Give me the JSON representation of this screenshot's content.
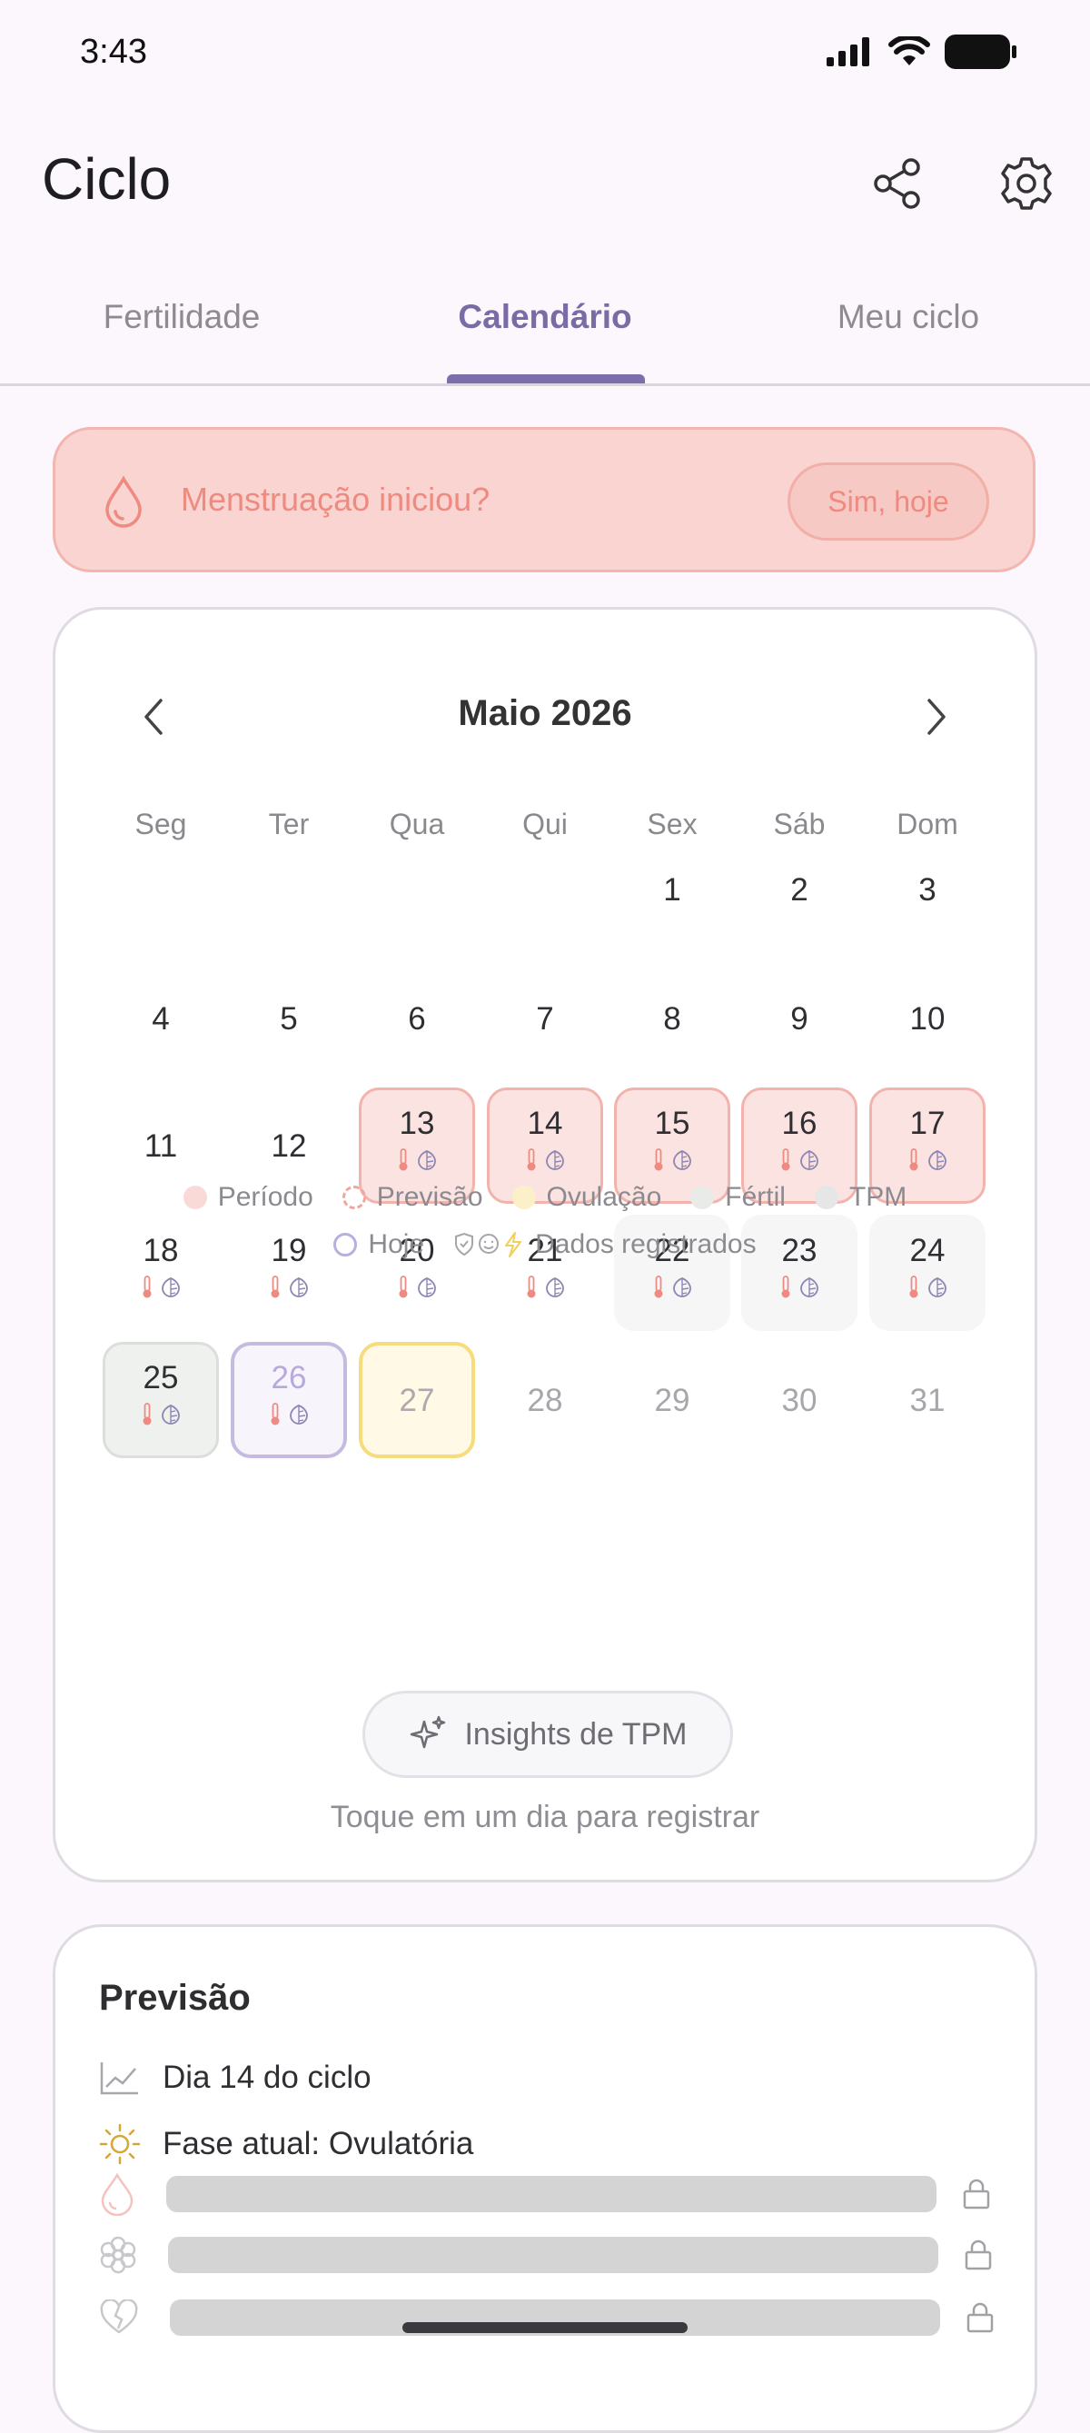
{
  "status_bar": {
    "time": "3:43"
  },
  "header": {
    "title": "Ciclo",
    "share_icon": "share-icon",
    "settings_icon": "gear-icon"
  },
  "tabs": [
    {
      "label": "Fertilidade",
      "active": false
    },
    {
      "label": "Calendário",
      "active": true
    },
    {
      "label": "Meu ciclo",
      "active": false
    }
  ],
  "period_banner": {
    "question": "Menstruação iniciou?",
    "button_label": "Sim, hoje"
  },
  "calendar": {
    "month_label": "Maio 2026",
    "weekdays": [
      "Seg",
      "Ter",
      "Qua",
      "Qui",
      "Sex",
      "Sáb",
      "Dom"
    ],
    "days": [
      {
        "n": "1",
        "state": "normal",
        "icons": false
      },
      {
        "n": "2",
        "state": "normal",
        "icons": false
      },
      {
        "n": "3",
        "state": "normal",
        "icons": false
      },
      {
        "n": "4",
        "state": "normal",
        "icons": false
      },
      {
        "n": "5",
        "state": "normal",
        "icons": false
      },
      {
        "n": "6",
        "state": "normal",
        "icons": false
      },
      {
        "n": "7",
        "state": "normal",
        "icons": false
      },
      {
        "n": "8",
        "state": "normal",
        "icons": false
      },
      {
        "n": "9",
        "state": "normal",
        "icons": false
      },
      {
        "n": "10",
        "state": "normal",
        "icons": false
      },
      {
        "n": "11",
        "state": "normal",
        "icons": false
      },
      {
        "n": "12",
        "state": "normal",
        "icons": false
      },
      {
        "n": "13",
        "state": "period",
        "icons": true
      },
      {
        "n": "14",
        "state": "period",
        "icons": true
      },
      {
        "n": "15",
        "state": "period",
        "icons": true
      },
      {
        "n": "16",
        "state": "period",
        "icons": true
      },
      {
        "n": "17",
        "state": "period",
        "icons": true
      },
      {
        "n": "18",
        "state": "normal",
        "icons": true
      },
      {
        "n": "19",
        "state": "normal",
        "icons": true
      },
      {
        "n": "20",
        "state": "normal",
        "icons": true
      },
      {
        "n": "21",
        "state": "normal",
        "icons": true
      },
      {
        "n": "22",
        "state": "tpm",
        "icons": true
      },
      {
        "n": "23",
        "state": "tpm",
        "icons": true
      },
      {
        "n": "24",
        "state": "tpm",
        "icons": true
      },
      {
        "n": "25",
        "state": "fertile",
        "icons": true
      },
      {
        "n": "26",
        "state": "today",
        "icons": true
      },
      {
        "n": "27",
        "state": "ovulation",
        "icons": false
      },
      {
        "n": "28",
        "state": "future",
        "icons": false
      },
      {
        "n": "29",
        "state": "future",
        "icons": false
      },
      {
        "n": "30",
        "state": "future",
        "icons": false
      },
      {
        "n": "31",
        "state": "future",
        "icons": false
      }
    ],
    "first_weekday_index": 4,
    "legend": {
      "period": "Período",
      "forecast": "Previsão",
      "ovulation": "Ovulação",
      "fertile": "Fértil",
      "tpm": "TPM",
      "today": "Hoje",
      "logged": "Dados registrados"
    },
    "insights_button": "Insights de TPM",
    "tap_hint": "Toque em um dia para registrar"
  },
  "prediction": {
    "title": "Previsão",
    "cycle_day": "Dia 14 do ciclo",
    "phase": "Fase atual: Ovulatória"
  },
  "colors": {
    "accent": "#7D6DAA",
    "period": "#F3B3AD",
    "ovulation": "#F6DC7C",
    "background": "#FCF6FD"
  }
}
